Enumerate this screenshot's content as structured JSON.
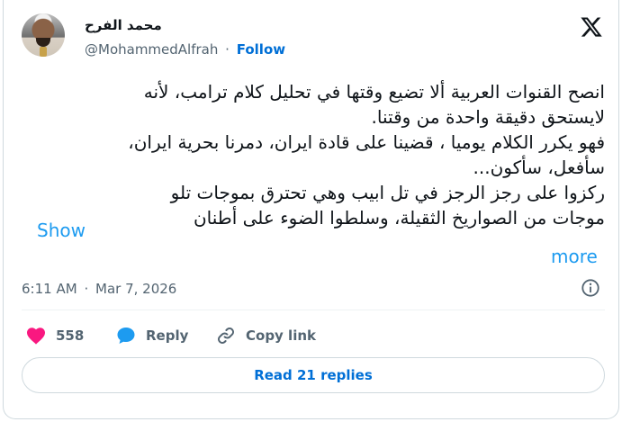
{
  "author": {
    "name": "محمد الفرح",
    "handle": "@MohammedAlfrah",
    "separator": "·",
    "follow_label": "Follow"
  },
  "tweet": {
    "lines": [
      "انصح القنوات العربية ألا تضيع وقتها في تحليل كلام ترامب، لأنه",
      "لايستحق دقيقة واحدة من وقتنا.",
      "فهو يكرر الكلام يوميا ، قضينا على قادة ايران، دمرنا بحرية ايران،",
      "سأفعل، سأكون...",
      "ركزوا على رجز الرجز في تل ابيب وهي تحترق بموجات تلو",
      "موجات من الصواريخ الثقيلة، وسلطوا الضوء على أطنان"
    ],
    "show_more_word1": "Show",
    "show_more_word2": "more"
  },
  "meta": {
    "time": "6:11 AM",
    "separator": "·",
    "date": "Mar 7, 2026"
  },
  "actions": {
    "like_count": "558",
    "reply_label": "Reply",
    "copy_label": "Copy link"
  },
  "replies_button": "Read 21 replies",
  "icons": {
    "logo": "x-logo-icon",
    "like": "heart-icon",
    "reply": "speech-bubble-icon",
    "copy": "link-icon",
    "info": "info-icon"
  },
  "colors": {
    "accent": "#1d9bf0",
    "link": "#006fd6",
    "like": "#f91880",
    "muted": "#536471"
  }
}
